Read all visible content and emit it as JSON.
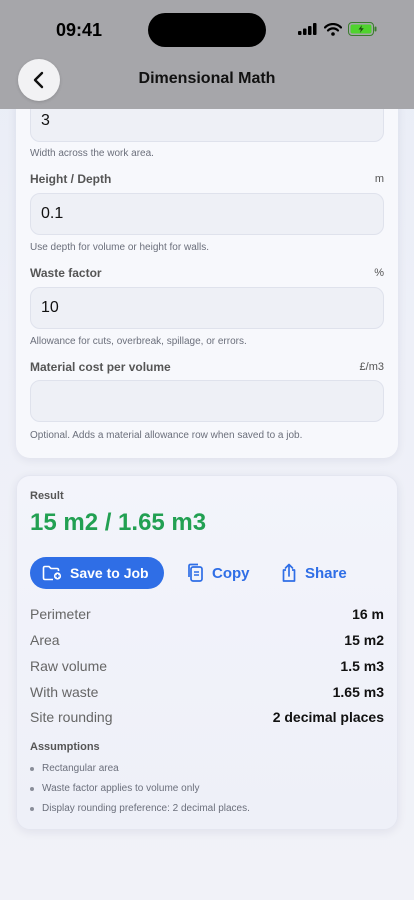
{
  "status": {
    "time": "09:41"
  },
  "nav": {
    "title": "Dimensional Math"
  },
  "inputs": {
    "width": {
      "value": "3",
      "hint": "Width across the work area."
    },
    "height": {
      "label": "Height / Depth",
      "unit": "m",
      "value": "0.1",
      "hint": "Use depth for volume or height for walls."
    },
    "waste": {
      "label": "Waste factor",
      "unit": "%",
      "value": "10",
      "hint": "Allowance for cuts, overbreak, spillage, or errors."
    },
    "cost": {
      "label": "Material cost per volume",
      "unit": "£/m3",
      "value": "",
      "hint": "Optional. Adds a material allowance row when saved to a job."
    }
  },
  "result": {
    "label": "Result",
    "value": "15 m2 / 1.65 m3",
    "actions": {
      "save": "Save to Job",
      "copy": "Copy",
      "share": "Share"
    },
    "rows": [
      {
        "key": "Perimeter",
        "value": "16 m"
      },
      {
        "key": "Area",
        "value": "15 m2"
      },
      {
        "key": "Raw volume",
        "value": "1.5 m3"
      },
      {
        "key": "With waste",
        "value": "1.65 m3"
      },
      {
        "key": "Site rounding",
        "value": "2 decimal places"
      }
    ],
    "assumptions_title": "Assumptions",
    "assumptions": [
      "Rectangular area",
      "Waste factor applies to volume only",
      "Display rounding preference: 2 decimal places."
    ]
  },
  "colors": {
    "accent": "#2f6ee6",
    "result": "#22a052",
    "topbar": "#a6a6aa"
  }
}
